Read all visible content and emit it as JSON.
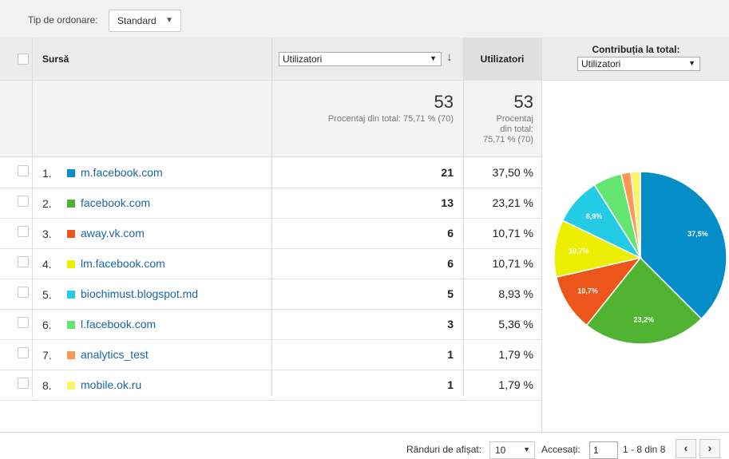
{
  "toolbar": {
    "sort_label": "Tip de ordonare:",
    "sort_value": "Standard"
  },
  "header": {
    "source_label": "Sursă",
    "metric_select": "Utilizatori",
    "users_label": "Utilizatori",
    "contrib_title": "Contribuția la total:",
    "contrib_select": "Utilizatori"
  },
  "totals": {
    "col1_value": "53",
    "col1_note": "Procentaj din total: 75,71 % (70)",
    "col2_value": "53",
    "col2_note_line1": "Procentaj",
    "col2_note_line2": "din total:",
    "col2_note_line3": "75,71 % (70)"
  },
  "rows": [
    {
      "num": "1.",
      "source": "m.facebook.com",
      "value": "21",
      "pct": "37,50 %",
      "color": "#058dc7"
    },
    {
      "num": "2.",
      "source": "facebook.com",
      "value": "13",
      "pct": "23,21 %",
      "color": "#50b432"
    },
    {
      "num": "3.",
      "source": "away.vk.com",
      "value": "6",
      "pct": "10,71 %",
      "color": "#ed561b"
    },
    {
      "num": "4.",
      "source": "lm.facebook.com",
      "value": "6",
      "pct": "10,71 %",
      "color": "#edef00"
    },
    {
      "num": "5.",
      "source": "biochimust.blogspot.md",
      "value": "5",
      "pct": "8,93 %",
      "color": "#24cbe5"
    },
    {
      "num": "6.",
      "source": "l.facebook.com",
      "value": "3",
      "pct": "5,36 %",
      "color": "#64e572"
    },
    {
      "num": "7.",
      "source": "analytics_test",
      "value": "1",
      "pct": "1,79 %",
      "color": "#ff9655"
    },
    {
      "num": "8.",
      "source": "mobile.ok.ru",
      "value": "1",
      "pct": "1,79 %",
      "color": "#fff263"
    }
  ],
  "pie": {
    "values": [
      37.5,
      23.21,
      10.71,
      10.71,
      8.93,
      5.36,
      1.79,
      1.79
    ],
    "labels": [
      "37,5%",
      "23,2%",
      "10,7%",
      "10,7%",
      "8,9%",
      "",
      "",
      ""
    ]
  },
  "footer": {
    "rows_label": "Rânduri de afișat:",
    "rows_value": "10",
    "goto_label": "Accesați:",
    "goto_value": "1",
    "range_text": "1 - 8 din 8",
    "prev_icon": "‹",
    "next_icon": "›"
  }
}
